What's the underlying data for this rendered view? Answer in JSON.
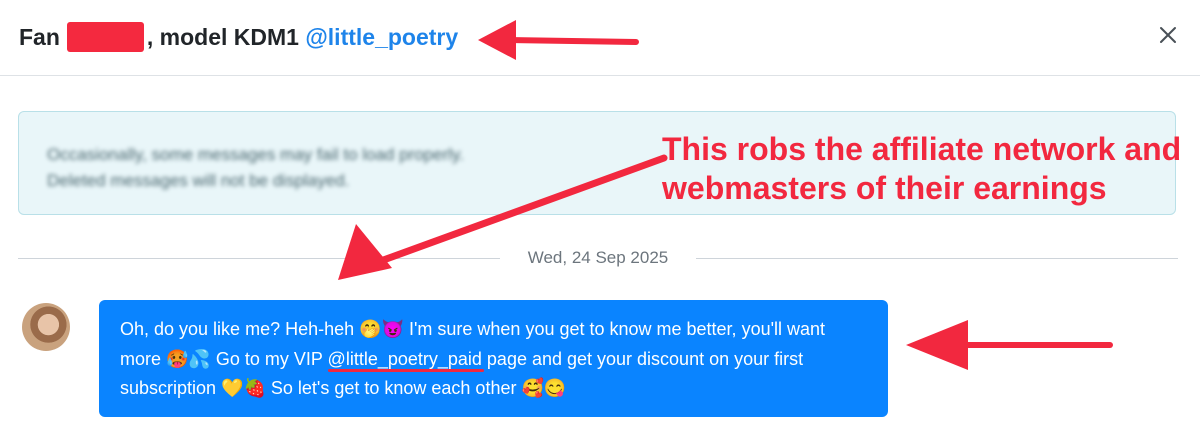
{
  "header": {
    "fan_label": "Fan",
    "model_text": ", model KDM1",
    "handle": "@little_poetry",
    "close_icon": "close-icon"
  },
  "notice": {
    "line1": "Occasionally, some messages may fail to load properly.",
    "line2": "Deleted messages will not be displayed."
  },
  "annotation": {
    "line1": "This robs the affiliate network and",
    "line2": "webmasters of their earnings"
  },
  "date_separator": "Wed, 24 Sep 2025",
  "message": {
    "part1": "Oh, do you like me? Heh-heh 🤭😈 I'm sure when you get to know me better, you'll want more 🥵💦 Go to my VIP ",
    "mention": "@little_poetry_paid",
    "part2": " page and get your discount on your first subscription 💛🍓 So let's get to know each other 🥰😋"
  },
  "colors": {
    "accent_blue": "#0a84ff",
    "link_blue": "#1e84ea",
    "annotation_red": "#f2283f",
    "notice_bg": "#e9f6f9"
  }
}
